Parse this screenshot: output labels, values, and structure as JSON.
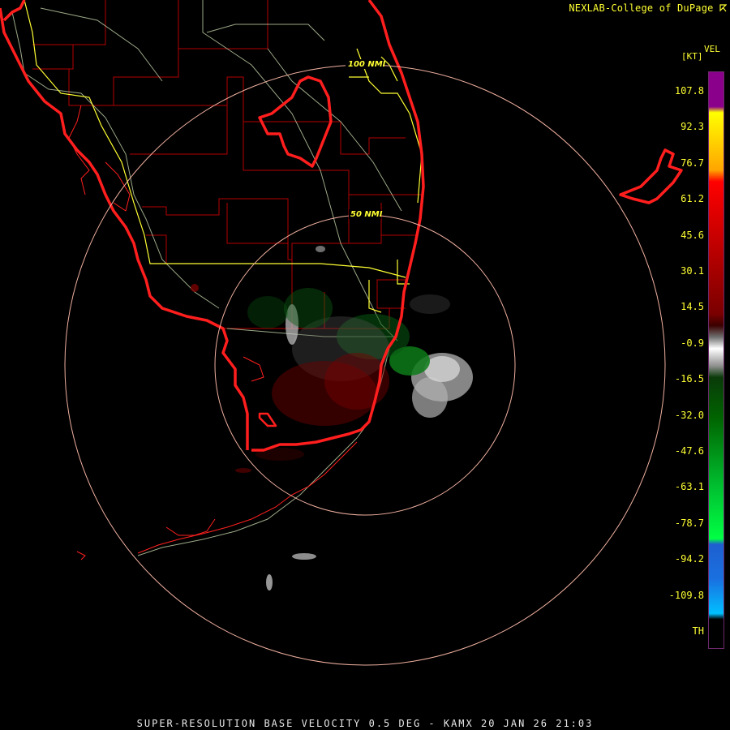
{
  "credit": "NEXLAB-College of DuPage",
  "credit_icon": "cursor-arrow-icon",
  "product": {
    "caption": "SUPER-RESOLUTION BASE VELOCITY 0.5 DEG - KAMX 20 JAN 26 21:03"
  },
  "legend": {
    "title": "VEL",
    "unit": "[KT]",
    "labels": [
      "107.8",
      "92.3",
      "76.7",
      "61.2",
      "45.6",
      "30.1",
      "14.5",
      "-0.9",
      "-16.5",
      "-32.0",
      "-47.6",
      "-63.1",
      "-78.7",
      "-94.2",
      "-109.8",
      "TH"
    ],
    "colors": {
      "top": "#8b008b",
      "yellow": "#ffff00",
      "red": "#ff0000",
      "dark_red": "#7a0000",
      "gray": "#c8c8c8",
      "dark_green": "#006400",
      "green": "#00ff44",
      "blue": "#1e5fd0",
      "cyan": "#00bfff"
    }
  },
  "map": {
    "range_rings": [
      {
        "label": "100 NMI"
      },
      {
        "label": "50 NMI"
      }
    ],
    "colors": {
      "coast": "#ff1e1e",
      "county": "#b40000",
      "highway": "#d0d080",
      "yellow_lines": "#ffff33",
      "ring": "#f0b0a0"
    }
  }
}
